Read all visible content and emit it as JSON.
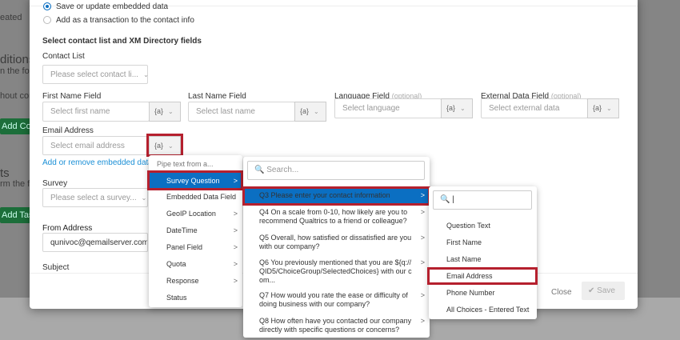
{
  "background": {
    "texts": [
      "eated",
      "ditions",
      "n the follo",
      "hout con",
      "ts",
      "rm the fo"
    ],
    "buttons": [
      "Add Con",
      "Add Tas"
    ]
  },
  "form": {
    "radio_options": [
      {
        "label": "Save or update embedded data",
        "checked": true
      },
      {
        "label": "Add as a transaction to the contact info",
        "checked": false
      }
    ],
    "section_title": "Select contact list and XM Directory fields",
    "contact_list": {
      "label": "Contact List",
      "placeholder": "Please select contact li..."
    },
    "first_name": {
      "label": "First Name Field",
      "placeholder": "Select first name"
    },
    "last_name": {
      "label": "Last Name Field",
      "placeholder": "Select last name"
    },
    "language": {
      "label": "Language Field",
      "optional": "(optional)",
      "placeholder": "Select language"
    },
    "external": {
      "label": "External Data Field",
      "optional": "(optional)",
      "placeholder": "Select external data"
    },
    "email": {
      "label": "Email Address",
      "placeholder": "Select email address"
    },
    "pipe_label": "{a}",
    "embedded_link": "Add or remove embedded data f",
    "survey": {
      "label": "Survey",
      "placeholder": "Please select a survey..."
    },
    "from_address": {
      "label": "From Address",
      "value": "qunivoc@qemailserver.com"
    },
    "subject_label": "Subject"
  },
  "footer": {
    "close": "Close",
    "save": "Save"
  },
  "pipe_menu": {
    "header": "Pipe text from a...",
    "items": [
      {
        "label": "Survey Question",
        "submenu": true,
        "selected": true
      },
      {
        "label": "Embedded Data Field",
        "submenu": false
      },
      {
        "label": "GeoIP Location",
        "submenu": true
      },
      {
        "label": "DateTime",
        "submenu": true
      },
      {
        "label": "Panel Field",
        "submenu": true
      },
      {
        "label": "Quota",
        "submenu": true
      },
      {
        "label": "Response",
        "submenu": true
      },
      {
        "label": "Status",
        "submenu": false
      }
    ]
  },
  "question_menu": {
    "search_placeholder": "Search...",
    "items": [
      {
        "label": "Q3 Please enter your contact information",
        "selected": true
      },
      {
        "label": "Q4 On a scale from 0-10, how likely are you to recommend Qualtrics to a friend or colleague?"
      },
      {
        "label": "Q5 Overall, how satisfied or dissatisfied are you with our company?"
      },
      {
        "label": "Q6 You previously mentioned that you are ${q://QID5/ChoiceGroup/SelectedChoices} with our com..."
      },
      {
        "label": "Q7 How would you rate the ease or difficulty of doing business with our company?"
      },
      {
        "label": "Q8 How often have you contacted our company directly with specific questions or concerns?"
      }
    ]
  },
  "field_menu": {
    "search_value": "|",
    "items": [
      "Question Text",
      "First Name",
      "Last Name",
      "Email Address",
      "Phone Number",
      "All Choices - Entered Text"
    ],
    "highlighted": "Email Address"
  },
  "arrow": ">",
  "colors": {
    "accent": "#0b6fc2",
    "highlight_border": "#b5202e",
    "link": "#1a8fd6",
    "bg_button": "#1c6e3a"
  }
}
